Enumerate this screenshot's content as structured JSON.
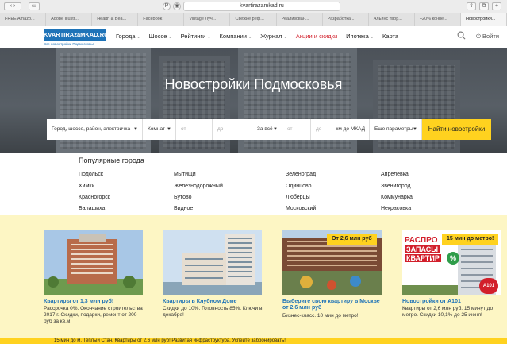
{
  "browser": {
    "url": "kvartirazamkad.ru",
    "tabs": [
      "FREE Amazo...",
      "Adobe Illustr...",
      "Health & Bea...",
      "Facebook",
      "Vintage Луч...",
      "Свежие реф...",
      "Реализован...",
      "Разработка...",
      "Альянс твор...",
      "+20% конве...",
      "Новостройки..."
    ]
  },
  "header": {
    "logo": "KVARTIRAzaMKAD.RU",
    "logo_sub": "Все новостройки Подмосковья",
    "nav": [
      "Города",
      "Шоссе",
      "Рейтинги",
      "Компании",
      "Журнал",
      "Акции и скидки",
      "Ипотека",
      "Карта"
    ],
    "login": "Войти"
  },
  "hero": {
    "title": "Новостройки Подмосковья"
  },
  "search": {
    "location": "Город, шоссе, район, электричка",
    "rooms": "Комнат",
    "from": "от",
    "to": "до",
    "price_unit": "За всё",
    "dist_from": "от",
    "dist_to": "до",
    "dist_unit": "км до МКАД",
    "more": "Еще параметры",
    "submit": "Найти новостройки"
  },
  "cities": {
    "title": "Популярные города",
    "columns": [
      [
        "Подольск",
        "Химки",
        "Красногорск",
        "Балашиха"
      ],
      [
        "Мытищи",
        "Железнодорожный",
        "Бутово",
        "Видное"
      ],
      [
        "Зеленоград",
        "Одинцово",
        "Люберцы",
        "Московский"
      ],
      [
        "Апрелевка",
        "Звенигород",
        "Коммунарка",
        "Некрасовка"
      ]
    ]
  },
  "promos": [
    {
      "title": "Квартиры от 1,3 млн руб!",
      "text": "Рассрочка 0%. Окончание строительства 2017 г. Скидки, подарки, ремонт от 200 руб за кв.м.",
      "badge": ""
    },
    {
      "title": "Квартиры в Клубном Доме",
      "text": "Скидки до 10%. Готовность 85%. Ключи в декабре!",
      "badge": ""
    },
    {
      "title": "Выберите свою квартиру в Москве от 2,6 млн руб",
      "text": "Бизнес-класс. 10 мин до метро!",
      "badge": "От 2,6 млн руб"
    },
    {
      "title": "Новостройки от А101",
      "text": "Квартиры от 2,6 млн руб. 15 минут до метро. Скидки 10,1% до 25 июня!",
      "badge": "15 мин до метро!"
    }
  ],
  "promo4_banner": {
    "line1": "РАСПРО",
    "line2": "ЗАПАСЫ",
    "line3": "КВАРТИР",
    "percent": "%",
    "logo": "А101"
  },
  "bottom_strip": "15 мин до м. Теплый Стан. Квартиры от 2,6 млн руб! Развитая инфраструктура. Успейте забронировать!"
}
